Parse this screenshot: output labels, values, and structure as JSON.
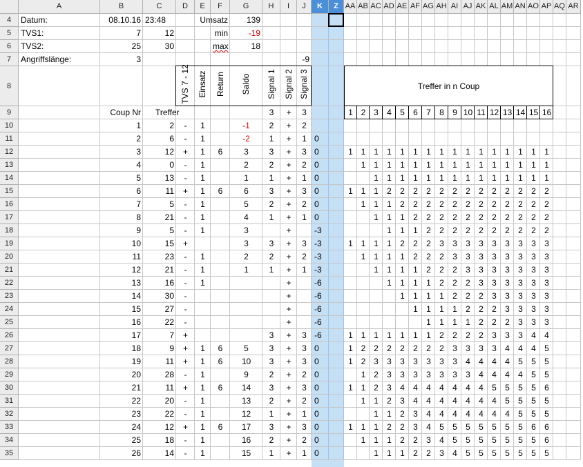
{
  "columns": [
    "A",
    "B",
    "C",
    "D",
    "E",
    "F",
    "G",
    "H",
    "I",
    "J",
    "K",
    "Z",
    "AA",
    "AB",
    "AC",
    "AD",
    "AE",
    "AF",
    "AG",
    "AH",
    "AI",
    "AJ",
    "AK",
    "AL",
    "AM",
    "AN",
    "AO",
    "AP",
    "AQ",
    "AR"
  ],
  "selected_columns": [
    "K",
    "Z"
  ],
  "rows": [
    "4",
    "5",
    "6",
    "7",
    "8",
    "9",
    "10",
    "11",
    "12",
    "13",
    "14",
    "15",
    "16",
    "17",
    "18",
    "19",
    "20",
    "21",
    "22",
    "23",
    "24",
    "25",
    "26",
    "27",
    "28",
    "29",
    "30",
    "31",
    "32",
    "33",
    "34",
    "35"
  ],
  "header_block": {
    "datum_label": "Datum:",
    "datum_date": "08.10.16",
    "datum_time": "23:48",
    "umsatz_label": "Umsatz",
    "umsatz_value": "139",
    "tvs1_label": "TVS1:",
    "tvs1_b": "7",
    "tvs1_c": "12",
    "min_label": "min",
    "min_value": "-19",
    "tvs2_label": "TVS2:",
    "tvs2_b": "25",
    "tvs2_c": "30",
    "max_label": "max",
    "max_value": "18",
    "angriff_label": "Angriffslänge:",
    "angriff_value": "3",
    "j7_value": "-9"
  },
  "vertical_headers": {
    "d": "TVS 7 - 12",
    "e": "Einsatz",
    "f": "Return",
    "g": "Saldo",
    "h": "Signal 1",
    "i": "Signal 2",
    "j": "Signal 3"
  },
  "treffer_in_n_coup": "Treffer in n Coup",
  "coup_nr_label": "Coup Nr",
  "treffer_label": "Treffer",
  "row9": {
    "h": "3",
    "i": "+",
    "j": "3"
  },
  "n_numbers": [
    "1",
    "2",
    "3",
    "4",
    "5",
    "6",
    "7",
    "8",
    "9",
    "10",
    "11",
    "12",
    "13",
    "14",
    "15",
    "16"
  ],
  "data_rows": [
    {
      "b": "1",
      "c": "2",
      "d": "-",
      "e": "1",
      "f": "",
      "g": "-1",
      "h": "2",
      "i": "+",
      "j": "2",
      "k": "",
      "n": [
        "",
        "",
        "",
        "",
        "",
        "",
        "",
        "",
        "",
        "",
        "",
        "",
        "",
        "",
        "",
        ""
      ]
    },
    {
      "b": "2",
      "c": "6",
      "d": "-",
      "e": "1",
      "f": "",
      "g": "-2",
      "h": "1",
      "i": "+",
      "j": "1",
      "k": "0",
      "n": [
        "",
        "",
        "",
        "",
        "",
        "",
        "",
        "",
        "",
        "",
        "",
        "",
        "",
        "",
        "",
        ""
      ]
    },
    {
      "b": "3",
      "c": "12",
      "d": "+",
      "e": "1",
      "f": "6",
      "g": "3",
      "h": "3",
      "i": "+",
      "j": "3",
      "k": "0",
      "n": [
        "1",
        "1",
        "1",
        "1",
        "1",
        "1",
        "1",
        "1",
        "1",
        "1",
        "1",
        "1",
        "1",
        "1",
        "1",
        "1"
      ]
    },
    {
      "b": "4",
      "c": "0",
      "d": "-",
      "e": "1",
      "f": "",
      "g": "2",
      "h": "2",
      "i": "+",
      "j": "2",
      "k": "0",
      "n": [
        "",
        "1",
        "1",
        "1",
        "1",
        "1",
        "1",
        "1",
        "1",
        "1",
        "1",
        "1",
        "1",
        "1",
        "1",
        "1"
      ]
    },
    {
      "b": "5",
      "c": "13",
      "d": "-",
      "e": "1",
      "f": "",
      "g": "1",
      "h": "1",
      "i": "+",
      "j": "1",
      "k": "0",
      "n": [
        "",
        "",
        "1",
        "1",
        "1",
        "1",
        "1",
        "1",
        "1",
        "1",
        "1",
        "1",
        "1",
        "1",
        "1",
        "1"
      ]
    },
    {
      "b": "6",
      "c": "11",
      "d": "+",
      "e": "1",
      "f": "6",
      "g": "6",
      "h": "3",
      "i": "+",
      "j": "3",
      "k": "0",
      "n": [
        "1",
        "1",
        "1",
        "2",
        "2",
        "2",
        "2",
        "2",
        "2",
        "2",
        "2",
        "2",
        "2",
        "2",
        "2",
        "2"
      ]
    },
    {
      "b": "7",
      "c": "5",
      "d": "-",
      "e": "1",
      "f": "",
      "g": "5",
      "h": "2",
      "i": "+",
      "j": "2",
      "k": "0",
      "n": [
        "",
        "1",
        "1",
        "1",
        "2",
        "2",
        "2",
        "2",
        "2",
        "2",
        "2",
        "2",
        "2",
        "2",
        "2",
        "2"
      ]
    },
    {
      "b": "8",
      "c": "21",
      "d": "-",
      "e": "1",
      "f": "",
      "g": "4",
      "h": "1",
      "i": "+",
      "j": "1",
      "k": "0",
      "n": [
        "",
        "",
        "1",
        "1",
        "1",
        "2",
        "2",
        "2",
        "2",
        "2",
        "2",
        "2",
        "2",
        "2",
        "2",
        "2"
      ]
    },
    {
      "b": "9",
      "c": "5",
      "d": "-",
      "e": "1",
      "f": "",
      "g": "3",
      "h": "",
      "i": "+",
      "j": "",
      "k": "-3",
      "n": [
        "",
        "",
        "",
        "1",
        "1",
        "1",
        "2",
        "2",
        "2",
        "2",
        "2",
        "2",
        "2",
        "2",
        "2",
        "2"
      ]
    },
    {
      "b": "10",
      "c": "15",
      "d": "+",
      "e": "",
      "f": "",
      "g": "3",
      "h": "3",
      "i": "+",
      "j": "3",
      "k": "-3",
      "n": [
        "1",
        "1",
        "1",
        "1",
        "2",
        "2",
        "2",
        "3",
        "3",
        "3",
        "3",
        "3",
        "3",
        "3",
        "3",
        "3"
      ]
    },
    {
      "b": "11",
      "c": "23",
      "d": "-",
      "e": "1",
      "f": "",
      "g": "2",
      "h": "2",
      "i": "+",
      "j": "2",
      "k": "-3",
      "n": [
        "",
        "1",
        "1",
        "1",
        "1",
        "2",
        "2",
        "2",
        "3",
        "3",
        "3",
        "3",
        "3",
        "3",
        "3",
        "3"
      ]
    },
    {
      "b": "12",
      "c": "21",
      "d": "-",
      "e": "1",
      "f": "",
      "g": "1",
      "h": "1",
      "i": "+",
      "j": "1",
      "k": "-3",
      "n": [
        "",
        "",
        "1",
        "1",
        "1",
        "1",
        "2",
        "2",
        "2",
        "3",
        "3",
        "3",
        "3",
        "3",
        "3",
        "3"
      ]
    },
    {
      "b": "13",
      "c": "16",
      "d": "-",
      "e": "1",
      "f": "",
      "g": "",
      "h": "",
      "i": "+",
      "j": "",
      "k": "-6",
      "n": [
        "",
        "",
        "",
        "1",
        "1",
        "1",
        "1",
        "2",
        "2",
        "2",
        "3",
        "3",
        "3",
        "3",
        "3",
        "3"
      ]
    },
    {
      "b": "14",
      "c": "30",
      "d": "-",
      "e": "",
      "f": "",
      "g": "",
      "h": "",
      "i": "+",
      "j": "",
      "k": "-6",
      "n": [
        "",
        "",
        "",
        "",
        "1",
        "1",
        "1",
        "1",
        "2",
        "2",
        "2",
        "3",
        "3",
        "3",
        "3",
        "3"
      ]
    },
    {
      "b": "15",
      "c": "27",
      "d": "-",
      "e": "",
      "f": "",
      "g": "",
      "h": "",
      "i": "+",
      "j": "",
      "k": "-6",
      "n": [
        "",
        "",
        "",
        "",
        "",
        "1",
        "1",
        "1",
        "1",
        "2",
        "2",
        "2",
        "3",
        "3",
        "3",
        "3"
      ]
    },
    {
      "b": "16",
      "c": "22",
      "d": "-",
      "e": "",
      "f": "",
      "g": "",
      "h": "",
      "i": "+",
      "j": "",
      "k": "-6",
      "n": [
        "",
        "",
        "",
        "",
        "",
        "",
        "1",
        "1",
        "1",
        "1",
        "2",
        "2",
        "2",
        "3",
        "3",
        "3"
      ]
    },
    {
      "b": "17",
      "c": "7",
      "d": "+",
      "e": "",
      "f": "",
      "g": "",
      "h": "3",
      "i": "+",
      "j": "3",
      "k": "-6",
      "n": [
        "1",
        "1",
        "1",
        "1",
        "1",
        "1",
        "1",
        "2",
        "2",
        "2",
        "2",
        "3",
        "3",
        "3",
        "4",
        "4"
      ]
    },
    {
      "b": "18",
      "c": "9",
      "d": "+",
      "e": "1",
      "f": "6",
      "g": "5",
      "h": "3",
      "i": "+",
      "j": "3",
      "k": "0",
      "n": [
        "1",
        "2",
        "2",
        "2",
        "2",
        "2",
        "2",
        "2",
        "3",
        "3",
        "3",
        "3",
        "4",
        "4",
        "4",
        "5"
      ]
    },
    {
      "b": "19",
      "c": "11",
      "d": "+",
      "e": "1",
      "f": "6",
      "g": "10",
      "h": "3",
      "i": "+",
      "j": "3",
      "k": "0",
      "n": [
        "1",
        "2",
        "3",
        "3",
        "3",
        "3",
        "3",
        "3",
        "3",
        "4",
        "4",
        "4",
        "4",
        "5",
        "5",
        "5"
      ]
    },
    {
      "b": "20",
      "c": "28",
      "d": "-",
      "e": "1",
      "f": "",
      "g": "9",
      "h": "2",
      "i": "+",
      "j": "2",
      "k": "0",
      "n": [
        "",
        "1",
        "2",
        "3",
        "3",
        "3",
        "3",
        "3",
        "3",
        "3",
        "4",
        "4",
        "4",
        "4",
        "5",
        "5"
      ]
    },
    {
      "b": "21",
      "c": "11",
      "d": "+",
      "e": "1",
      "f": "6",
      "g": "14",
      "h": "3",
      "i": "+",
      "j": "3",
      "k": "0",
      "n": [
        "1",
        "1",
        "2",
        "3",
        "4",
        "4",
        "4",
        "4",
        "4",
        "4",
        "4",
        "5",
        "5",
        "5",
        "5",
        "6"
      ]
    },
    {
      "b": "22",
      "c": "20",
      "d": "-",
      "e": "1",
      "f": "",
      "g": "13",
      "h": "2",
      "i": "+",
      "j": "2",
      "k": "0",
      "n": [
        "",
        "1",
        "1",
        "2",
        "3",
        "4",
        "4",
        "4",
        "4",
        "4",
        "4",
        "4",
        "5",
        "5",
        "5",
        "5"
      ]
    },
    {
      "b": "23",
      "c": "22",
      "d": "-",
      "e": "1",
      "f": "",
      "g": "12",
      "h": "1",
      "i": "+",
      "j": "1",
      "k": "0",
      "n": [
        "",
        "",
        "1",
        "1",
        "2",
        "3",
        "4",
        "4",
        "4",
        "4",
        "4",
        "4",
        "4",
        "5",
        "5",
        "5"
      ]
    },
    {
      "b": "24",
      "c": "12",
      "d": "+",
      "e": "1",
      "f": "6",
      "g": "17",
      "h": "3",
      "i": "+",
      "j": "3",
      "k": "0",
      "n": [
        "1",
        "1",
        "1",
        "2",
        "2",
        "3",
        "4",
        "5",
        "5",
        "5",
        "5",
        "5",
        "5",
        "5",
        "6",
        "6"
      ]
    },
    {
      "b": "25",
      "c": "18",
      "d": "-",
      "e": "1",
      "f": "",
      "g": "16",
      "h": "2",
      "i": "+",
      "j": "2",
      "k": "0",
      "n": [
        "",
        "1",
        "1",
        "1",
        "2",
        "2",
        "3",
        "4",
        "5",
        "5",
        "5",
        "5",
        "5",
        "5",
        "5",
        "6"
      ]
    },
    {
      "b": "26",
      "c": "14",
      "d": "-",
      "e": "1",
      "f": "",
      "g": "15",
      "h": "1",
      "i": "+",
      "j": "1",
      "k": "0",
      "n": [
        "",
        "",
        "1",
        "1",
        "1",
        "2",
        "2",
        "3",
        "4",
        "5",
        "5",
        "5",
        "5",
        "5",
        "5",
        "5"
      ]
    }
  ],
  "red_values": [
    "-1",
    "-2",
    "-19"
  ]
}
